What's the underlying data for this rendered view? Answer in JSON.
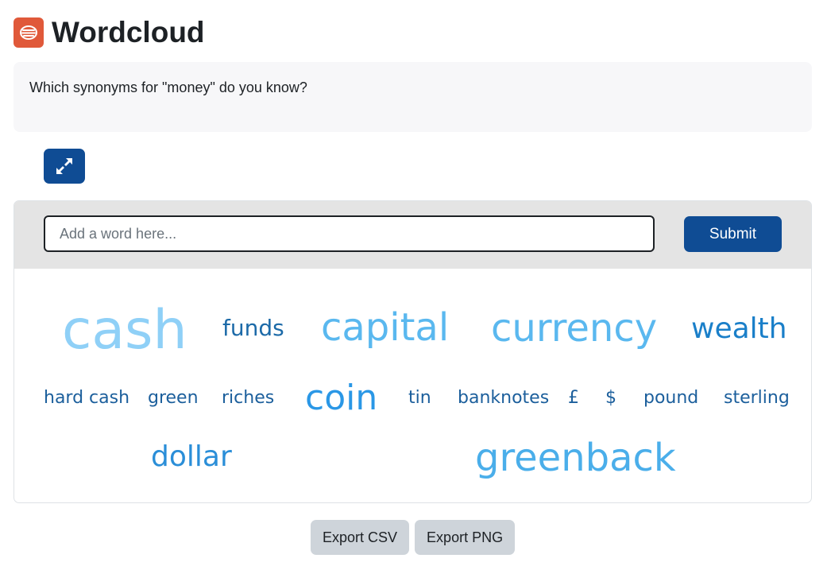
{
  "page": {
    "title": "Wordcloud",
    "icon": "wordcloud-icon",
    "accent_color": "#e0593a"
  },
  "intro": {
    "question": "Which synonyms for \"money\" do you know?"
  },
  "toolbar": {
    "fullscreen_icon": "expand-arrows-icon",
    "button_color": "#0f4c94"
  },
  "form": {
    "placeholder": "Add a word here...",
    "submit_label": "Submit"
  },
  "wordcloud": {
    "words": [
      {
        "text": "cash",
        "color": "#8fd0f7"
      },
      {
        "text": "funds",
        "color": "#1c6aa8"
      },
      {
        "text": "capital",
        "color": "#5ab8ef"
      },
      {
        "text": "currency",
        "color": "#5ab8ef"
      },
      {
        "text": "wealth",
        "color": "#1a7fc9"
      },
      {
        "text": "hard cash",
        "color": "#1c5f9c"
      },
      {
        "text": "green",
        "color": "#1c5f9c"
      },
      {
        "text": "riches",
        "color": "#1c5f9c"
      },
      {
        "text": "coin",
        "color": "#2a97e6"
      },
      {
        "text": "tin",
        "color": "#1c5f9c"
      },
      {
        "text": "banknotes",
        "color": "#1c5f9c"
      },
      {
        "text": "£",
        "color": "#1c5f9c"
      },
      {
        "text": "$",
        "color": "#1c5f9c"
      },
      {
        "text": "pound",
        "color": "#1c5f9c"
      },
      {
        "text": "sterling",
        "color": "#1c5f9c"
      },
      {
        "text": "dollar",
        "color": "#2a8ed8"
      },
      {
        "text": "greenback",
        "color": "#4aaeea"
      }
    ]
  },
  "exports": {
    "csv_label": "Export CSV",
    "png_label": "Export PNG"
  }
}
